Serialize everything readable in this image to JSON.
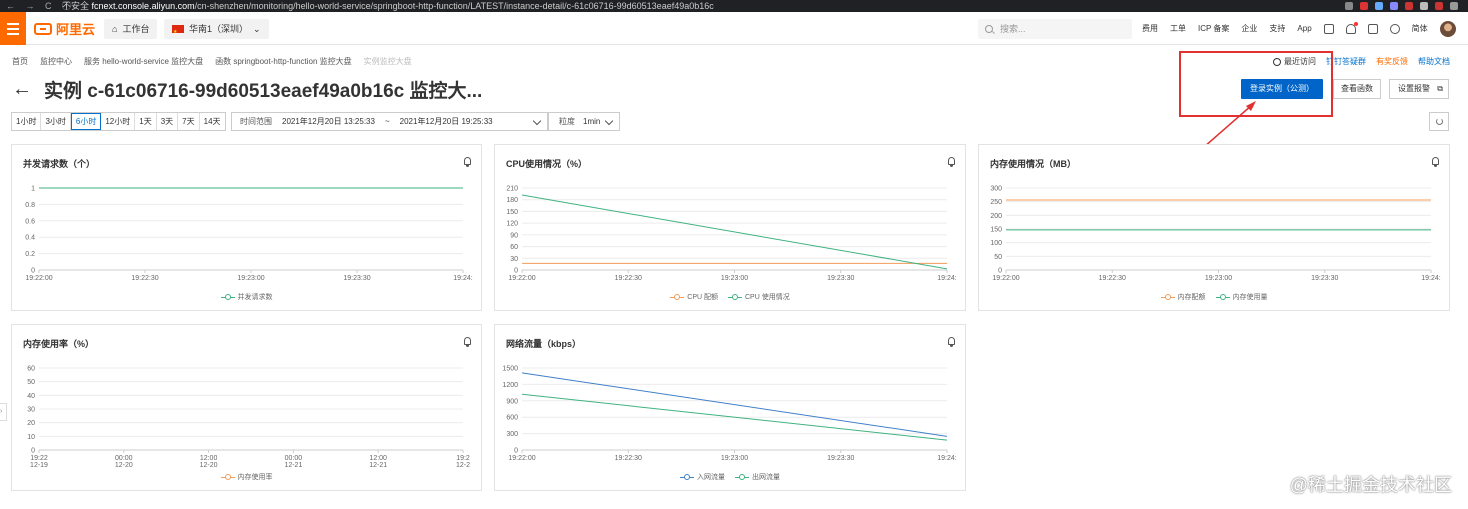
{
  "browser": {
    "security": "不安全",
    "url_host": "fcnext.console.aliyun.com",
    "url_path": "/cn-shenzhen/monitoring/hello-world-service/springboot-http-function/LATEST/instance-detail/c-61c06716-99d60513eaef49a0b16c"
  },
  "topbar": {
    "logo_text": "阿里云",
    "workbench": "工作台",
    "region": "华南1（深圳）",
    "search_placeholder": "搜索...",
    "links": [
      "费用",
      "工单",
      "ICP 备案",
      "企业",
      "支持",
      "App"
    ],
    "lang": "简体"
  },
  "breadcrumb": [
    "首页",
    "监控中心",
    "服务 hello-world-service 监控大盘",
    "函数 springboot-http-function 监控大盘",
    "实例监控大盘"
  ],
  "help": {
    "recent": "最近访问",
    "dingtalk": "钉钉答疑群",
    "feedback": "有奖反馈",
    "docs": "帮助文档"
  },
  "page": {
    "title": "实例 c-61c06716-99d60513eaef49a0b16c 监控大...",
    "login_btn": "登录实例（公测）",
    "view_func_btn": "查看函数",
    "alarm_btn": "设置报警"
  },
  "filters": {
    "time_buttons": [
      "1小时",
      "3小时",
      "6小时",
      "12小时",
      "1天",
      "3天",
      "7天",
      "14天"
    ],
    "active": "6小时",
    "range_label": "时间范围",
    "range_start": "2021年12月20日 13:25:33",
    "range_sep": "~",
    "range_end": "2021年12月20日 19:25:33",
    "granularity_label": "粒度",
    "granularity_value": "1min"
  },
  "watermark": "@稀土掘金技术社区",
  "chart_data": [
    {
      "type": "line",
      "title": "并发请求数（个）",
      "x": [
        "19:22:00",
        "19:22:30",
        "19:23:00",
        "19:23:30",
        "19:24:"
      ],
      "ylim": [
        0,
        1
      ],
      "yticks": [
        "0",
        "0.2",
        "0.4",
        "0.6",
        "0.8",
        "1"
      ],
      "series": [
        {
          "name": "并发请求数",
          "color": "#3fb27f",
          "values": [
            1,
            1
          ]
        }
      ],
      "grid": true,
      "legend": "bottom"
    },
    {
      "type": "line",
      "title": "CPU使用情况（%）",
      "x": [
        "19:22:00",
        "19:22:30",
        "19:23:00",
        "19:23:30",
        "19:24:"
      ],
      "ylim": [
        0,
        210
      ],
      "yticks": [
        "0",
        "30",
        "60",
        "90",
        "120",
        "150",
        "180",
        "210"
      ],
      "series": [
        {
          "name": "CPU 配额",
          "color": "#f39c5a",
          "values": [
            17,
            17
          ]
        },
        {
          "name": "CPU 使用情况",
          "color": "#3fb27f",
          "values": [
            192,
            3
          ]
        }
      ],
      "grid": true,
      "legend": "bottom"
    },
    {
      "type": "line",
      "title": "内存使用情况（MB）",
      "x": [
        "19:22:00",
        "19:22:30",
        "19:23:00",
        "19:23:30",
        "19:24:"
      ],
      "ylim": [
        0,
        300
      ],
      "yticks": [
        "0",
        "50",
        "100",
        "150",
        "200",
        "250",
        "300"
      ],
      "series": [
        {
          "name": "内存配额",
          "color": "#f39c5a",
          "values": [
            256,
            256
          ]
        },
        {
          "name": "内存使用量",
          "color": "#3fb27f",
          "values": [
            147,
            147
          ]
        }
      ],
      "grid": true,
      "legend": "bottom"
    },
    {
      "type": "line",
      "title": "内存使用率（%）",
      "x": [
        "19:22\n12-19",
        "00:00\n12-20",
        "12:00\n12-20",
        "00:00\n12-21",
        "12:00\n12-21",
        "19:2\n12-2"
      ],
      "ylim": [
        0,
        60
      ],
      "yticks": [
        "0",
        "10",
        "20",
        "30",
        "40",
        "50",
        "60"
      ],
      "series": [
        {
          "name": "内存使用率",
          "color": "#f39c5a",
          "values": []
        }
      ],
      "grid": true,
      "legend": "bottom"
    },
    {
      "type": "line",
      "title": "网络流量（kbps）",
      "x": [
        "19:22:00",
        "19:22:30",
        "19:23:00",
        "19:23:30",
        "19:24:"
      ],
      "ylim": [
        0,
        1500
      ],
      "yticks": [
        "0",
        "300",
        "600",
        "900",
        "1200",
        "1500"
      ],
      "series": [
        {
          "name": "入网流量",
          "color": "#3f80c8",
          "values": [
            1410,
            250
          ]
        },
        {
          "name": "出网流量",
          "color": "#3fb27f",
          "values": [
            1020,
            180
          ]
        }
      ],
      "grid": true,
      "legend": "bottom"
    }
  ]
}
